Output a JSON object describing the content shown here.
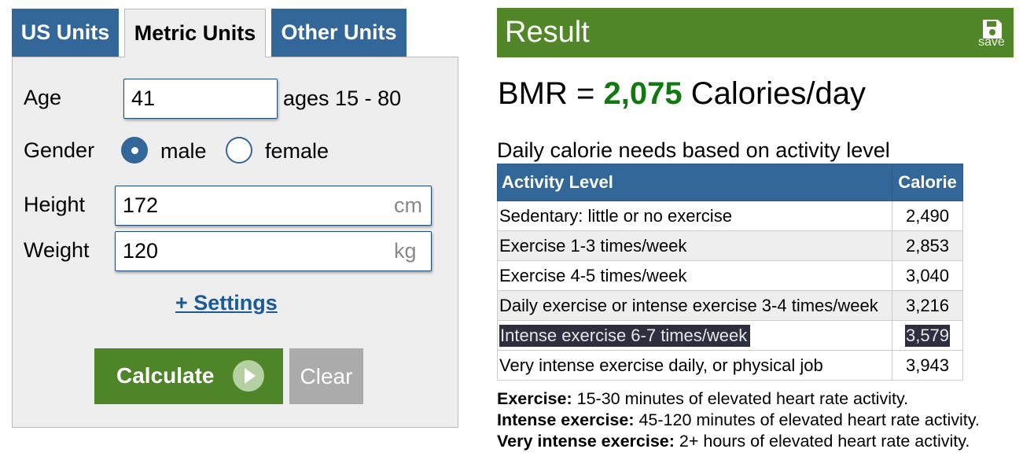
{
  "tabs": [
    {
      "label": "US Units"
    },
    {
      "label": "Metric Units",
      "active": true
    },
    {
      "label": "Other Units"
    }
  ],
  "form": {
    "age": {
      "label": "Age",
      "value": "41",
      "hint": "ages 15 - 80"
    },
    "gender": {
      "label": "Gender",
      "options": [
        "male",
        "female"
      ],
      "selected": "male"
    },
    "height": {
      "label": "Height",
      "value": "172",
      "unit": "cm"
    },
    "weight": {
      "label": "Weight",
      "value": "120",
      "unit": "kg"
    },
    "settings_link": "+ Settings",
    "calculate_label": "Calculate",
    "clear_label": "Clear"
  },
  "result": {
    "title": "Result",
    "save_label": "save",
    "bmr_prefix": "BMR = ",
    "bmr_value": "2,075",
    "bmr_suffix": " Calories/day",
    "daily_title": "Daily calorie needs based on activity level",
    "table": {
      "headers": [
        "Activity Level",
        "Calorie"
      ],
      "rows": [
        {
          "activity": "Sedentary: little or no exercise",
          "calorie": "2,490"
        },
        {
          "activity": "Exercise 1-3 times/week",
          "calorie": "2,853"
        },
        {
          "activity": "Exercise 4-5 times/week",
          "calorie": "3,040"
        },
        {
          "activity": "Daily exercise or intense exercise 3-4 times/week",
          "calorie": "3,216"
        },
        {
          "activity": "Intense exercise 6-7 times/week",
          "calorie": "3,579",
          "highlighted": true
        },
        {
          "activity": "Very intense exercise daily, or physical job",
          "calorie": "3,943"
        }
      ]
    },
    "notes": [
      {
        "term": "Exercise:",
        "text": " 15-30 minutes of elevated heart rate activity."
      },
      {
        "term": "Intense exercise:",
        "text": " 45-120 minutes of elevated heart rate activity."
      },
      {
        "term": "Very intense exercise:",
        "text": " 2+ hours of elevated heart rate activity."
      }
    ]
  },
  "colors": {
    "tab_blue": "#336699",
    "result_green": "#518728",
    "calculate_green": "#4e8529",
    "bmr_value_green": "#107a10",
    "clear_gray": "#ababab",
    "panel_bg": "#eeeeee"
  },
  "icons": {
    "save": "floppy-disk-icon",
    "calculate": "play-circle-icon"
  }
}
